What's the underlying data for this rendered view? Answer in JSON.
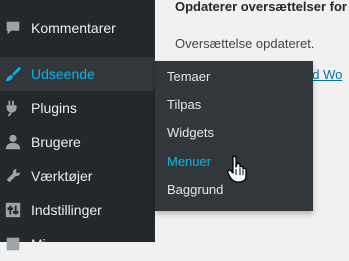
{
  "sidebar": {
    "items": [
      {
        "label": "Kommentarer",
        "icon": "comments-icon"
      },
      {
        "label": "Udseende",
        "icon": "brush-icon",
        "active": true
      },
      {
        "label": "Plugins",
        "icon": "plugin-icon"
      },
      {
        "label": "Brugere",
        "icon": "user-icon"
      },
      {
        "label": "Værktøjer",
        "icon": "wrench-icon"
      },
      {
        "label": "Indstillinger",
        "icon": "settings-icon"
      },
      {
        "label": "Mi...",
        "icon": "media-icon"
      }
    ]
  },
  "flyout": {
    "items": [
      {
        "label": "Temaer"
      },
      {
        "label": "Tilpas"
      },
      {
        "label": "Widgets"
      },
      {
        "label": "Menuer",
        "hover": true
      },
      {
        "label": "Baggrund"
      }
    ]
  },
  "content": {
    "title": "Opdaterer oversættelser for",
    "message": "Oversættelse opdateret.",
    "link": "ed Wo"
  },
  "colors": {
    "sidebar_bg": "#23282d",
    "flyout_bg": "#32373c",
    "accent": "#00b9eb",
    "link": "#0073aa"
  }
}
